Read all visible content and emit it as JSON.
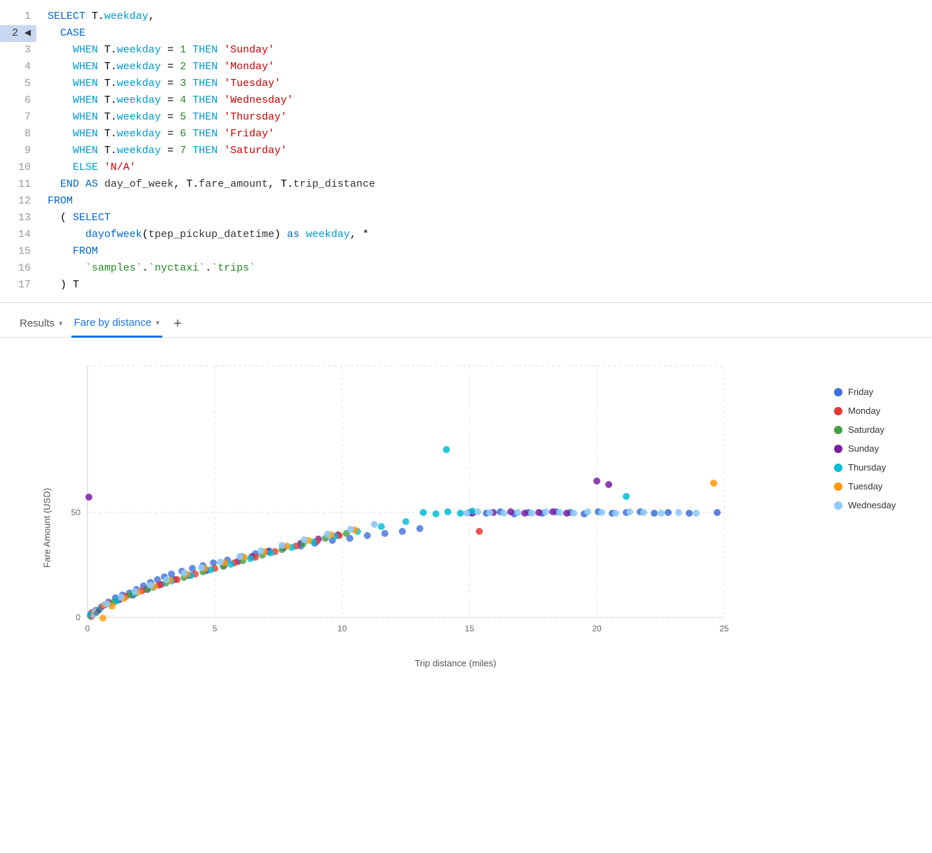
{
  "editor": {
    "lines": [
      {
        "num": 1,
        "active": false
      },
      {
        "num": 2,
        "active": true
      },
      {
        "num": 3,
        "active": false
      },
      {
        "num": 4,
        "active": false
      },
      {
        "num": 5,
        "active": false
      },
      {
        "num": 6,
        "active": false
      },
      {
        "num": 7,
        "active": false
      },
      {
        "num": 8,
        "active": false
      },
      {
        "num": 9,
        "active": false
      },
      {
        "num": 10,
        "active": false
      },
      {
        "num": 11,
        "active": false
      },
      {
        "num": 12,
        "active": false
      },
      {
        "num": 13,
        "active": false
      },
      {
        "num": 14,
        "active": false
      },
      {
        "num": 15,
        "active": false
      },
      {
        "num": 16,
        "active": false
      },
      {
        "num": 17,
        "active": false
      }
    ]
  },
  "tabs": {
    "results_label": "Results",
    "fare_label": "Fare by distance",
    "add_label": "+"
  },
  "chart": {
    "y_axis_label": "Fare Amount (USD)",
    "x_axis_label": "Trip distance (miles)",
    "y_max": 70,
    "y_ticks": [
      0,
      50
    ],
    "x_ticks": [
      0,
      5,
      10,
      15,
      20,
      25
    ]
  },
  "legend": {
    "items": [
      {
        "label": "Friday",
        "color": "#3d6fdb"
      },
      {
        "label": "Monday",
        "color": "#e53935"
      },
      {
        "label": "Saturday",
        "color": "#43a047"
      },
      {
        "label": "Sunday",
        "color": "#7b1fa2"
      },
      {
        "label": "Thursday",
        "color": "#00bcd4"
      },
      {
        "label": "Tuesday",
        "color": "#ff9800"
      },
      {
        "label": "Wednesday",
        "color": "#90caf9"
      }
    ]
  }
}
